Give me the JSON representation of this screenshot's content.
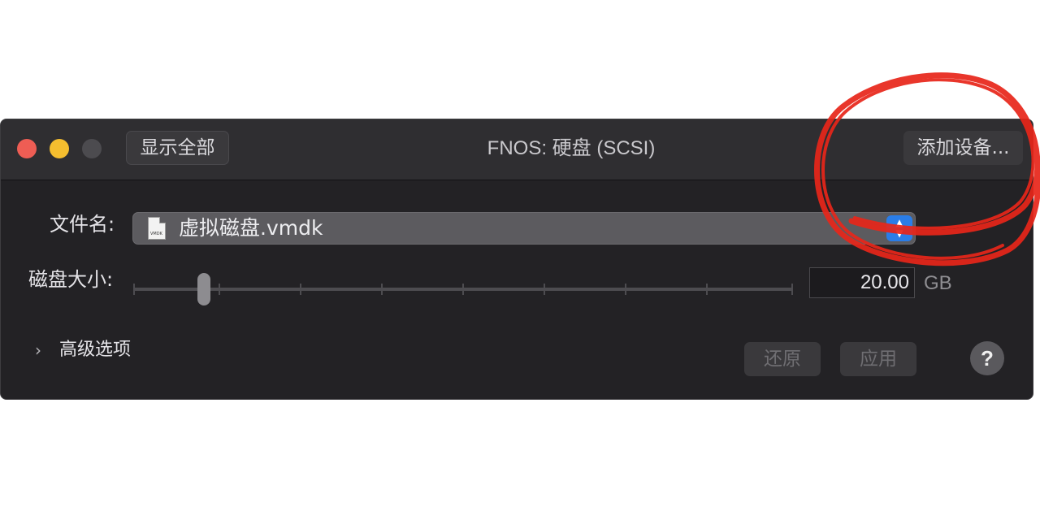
{
  "window": {
    "title": "FNOS: 硬盘 (SCSI)",
    "show_all_label": "显示全部",
    "add_device_label": "添加设备..."
  },
  "form": {
    "file_label": "文件名:",
    "file_value": "虚拟磁盘.vmdk",
    "file_icon_caption": "VMDK",
    "size_label": "磁盘大小:",
    "size_value": "20.00",
    "size_unit": "GB",
    "slider_fraction": 0.1
  },
  "advanced": {
    "label": "高级选项"
  },
  "actions": {
    "revert_label": "还原",
    "apply_label": "应用",
    "help_label": "?"
  },
  "colors": {
    "accent": "#2a7de8",
    "annotation": "#e8261a"
  }
}
